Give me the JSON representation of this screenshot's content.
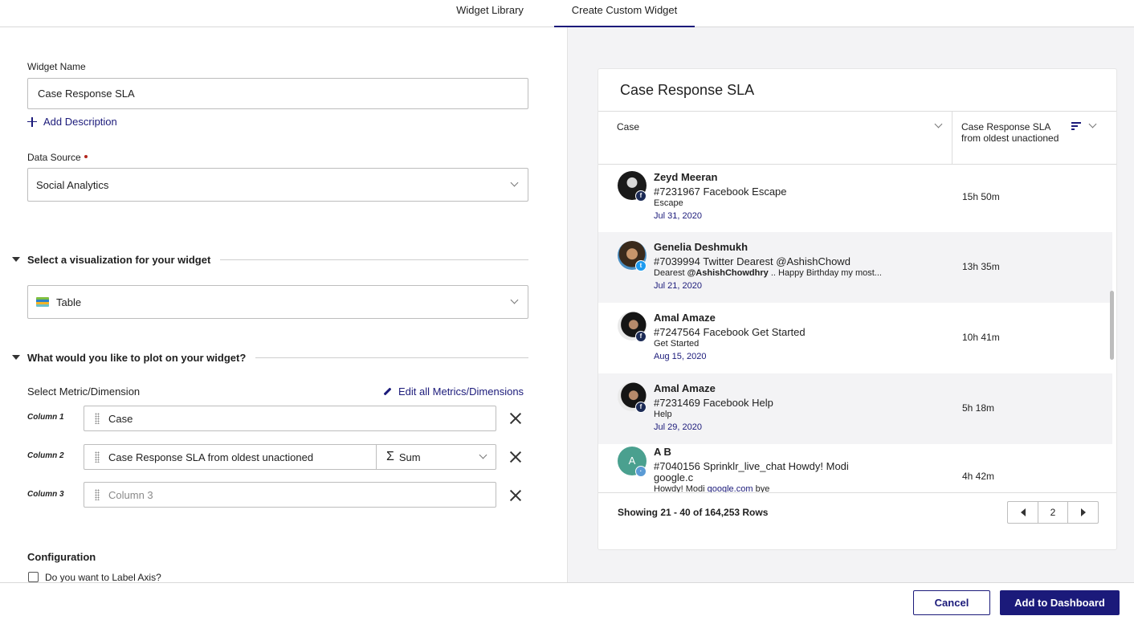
{
  "tabs": [
    {
      "label": "Widget Library",
      "active": false
    },
    {
      "label": "Create Custom Widget",
      "active": true
    }
  ],
  "form": {
    "widget_name_label": "Widget Name",
    "widget_name_value": "Case Response SLA",
    "add_description": "Add Description",
    "data_source_label": "Data Source",
    "data_source_value": "Social Analytics",
    "viz_section_title": "Select a visualization for your widget",
    "viz_value": "Table",
    "plot_section_title": "What would you like to plot on your widget?",
    "metric_label": "Select Metric/Dimension",
    "edit_all": "Edit all Metrics/Dimensions",
    "columns": [
      {
        "label": "Column 1",
        "value": "Case",
        "placeholder": ""
      },
      {
        "label": "Column 2",
        "value": "Case Response SLA from oldest unactioned",
        "aggregation": "Sum",
        "placeholder": ""
      },
      {
        "label": "Column 3",
        "value": "",
        "placeholder": "Column 3"
      }
    ],
    "sigma": "Σ",
    "configuration_title": "Configuration",
    "label_axis_question": "Do you want to Label Axis?"
  },
  "preview": {
    "title": "Case Response SLA",
    "col1_header": "Case",
    "col2_header": "Case Response SLA from oldest unactioned",
    "rows": [
      {
        "name": "Zeyd Meeran",
        "title": "#7231967 Facebook Escape",
        "sub": "Escape",
        "date": "Jul 31, 2020",
        "value": "15h 50m",
        "channel": "facebook-icon"
      },
      {
        "name": "Genelia Deshmukh",
        "title": "#7039994 Twitter Dearest @AshishChowd",
        "sub_prefix": "Dearest ",
        "sub_bold": "@AshishChowdhry",
        "sub_rest": " .. Happy Birthday my most...",
        "date": "Jul 21, 2020",
        "value": "13h 35m",
        "channel": "twitter-icon"
      },
      {
        "name": "Amal Amaze",
        "title": "#7247564 Facebook Get Started",
        "sub": "Get Started",
        "date": "Aug 15, 2020",
        "value": "10h 41m",
        "channel": "facebook-icon"
      },
      {
        "name": "Amal Amaze",
        "title": "#7231469 Facebook Help",
        "sub": "Help",
        "date": "Jul 29, 2020",
        "value": "5h 18m",
        "channel": "facebook-icon"
      },
      {
        "name": "A B",
        "avatar_initial": "A",
        "title": "#7040156 Sprinklr_live_chat Howdy! Modi",
        "title2": "google.c",
        "sub_prefix": "Howdy! Modi ",
        "sub_link": "google.com",
        "sub_rest": " bye",
        "date": "",
        "value": "4h 42m",
        "channel": "chat-icon"
      }
    ],
    "showing": "Showing 21 - 40 of 164,253 Rows",
    "page": "2"
  },
  "footer": {
    "cancel": "Cancel",
    "add": "Add to Dashboard"
  },
  "colors": {
    "accent": "#1b1a7a",
    "panel_bg": "#f3f3f5",
    "required": "#b3261e"
  }
}
